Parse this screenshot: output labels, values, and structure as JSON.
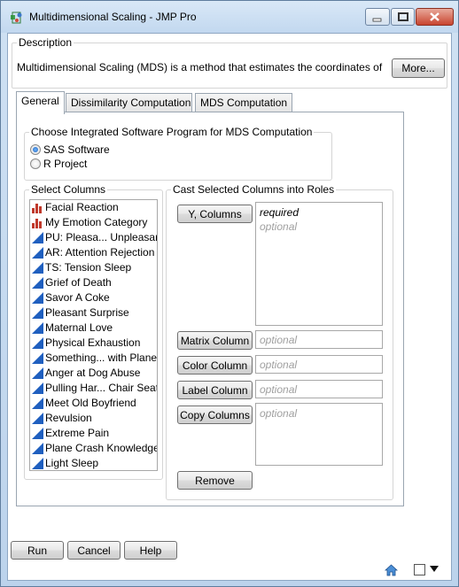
{
  "window": {
    "title": "Multidimensional Scaling - JMP Pro",
    "controls": {
      "minimize": "minimize",
      "maximize": "maximize",
      "close": "close"
    }
  },
  "description": {
    "legend": "Description",
    "text": "Multidimensional Scaling (MDS) is a method that estimates the coordinates of",
    "more_label": "More..."
  },
  "tabs": [
    {
      "label": "General",
      "active": true
    },
    {
      "label": "Dissimilarity Computation",
      "active": false
    },
    {
      "label": "MDS Computation",
      "active": false
    }
  ],
  "software": {
    "legend": "Choose Integrated Software Program for MDS Computation",
    "options": [
      {
        "label": "SAS Software",
        "checked": true
      },
      {
        "label": "R Project",
        "checked": false
      }
    ]
  },
  "select_columns": {
    "legend": "Select Columns",
    "items": [
      {
        "label": "Facial Reaction",
        "icon": "nominal-bar-icon"
      },
      {
        "label": "My Emotion Category",
        "icon": "nominal-bar-icon"
      },
      {
        "label": "PU: Pleasa... Unpleasant",
        "icon": "continuous-triangle-icon"
      },
      {
        "label": "AR: Attention Rejection",
        "icon": "continuous-triangle-icon"
      },
      {
        "label": "TS: Tension Sleep",
        "icon": "continuous-triangle-icon"
      },
      {
        "label": "Grief of Death",
        "icon": "continuous-triangle-icon"
      },
      {
        "label": "Savor A Coke",
        "icon": "continuous-triangle-icon"
      },
      {
        "label": "Pleasant Surprise",
        "icon": "continuous-triangle-icon"
      },
      {
        "label": "Maternal Love",
        "icon": "continuous-triangle-icon"
      },
      {
        "label": "Physical Exhaustion",
        "icon": "continuous-triangle-icon"
      },
      {
        "label": "Something... with Plane",
        "icon": "continuous-triangle-icon"
      },
      {
        "label": "Anger at Dog Abuse",
        "icon": "continuous-triangle-icon"
      },
      {
        "label": "Pulling Har... Chair Seat",
        "icon": "continuous-triangle-icon"
      },
      {
        "label": "Meet Old Boyfriend",
        "icon": "continuous-triangle-icon"
      },
      {
        "label": "Revulsion",
        "icon": "continuous-triangle-icon"
      },
      {
        "label": "Extreme Pain",
        "icon": "continuous-triangle-icon"
      },
      {
        "label": "Plane Crash Knowledge",
        "icon": "continuous-triangle-icon"
      },
      {
        "label": "Light Sleep",
        "icon": "continuous-triangle-icon"
      }
    ]
  },
  "roles": {
    "legend": "Cast Selected Columns into Roles",
    "y_columns": {
      "button": "Y, Columns",
      "required": "required",
      "optional": "optional"
    },
    "matrix": {
      "button": "Matrix Column",
      "placeholder": "optional"
    },
    "color": {
      "button": "Color Column",
      "placeholder": "optional"
    },
    "label": {
      "button": "Label Column",
      "placeholder": "optional"
    },
    "copy": {
      "button": "Copy Columns",
      "placeholder": "optional"
    },
    "remove_label": "Remove"
  },
  "actions": {
    "run": "Run",
    "cancel": "Cancel",
    "help": "Help"
  },
  "status": {
    "home_icon": "home-icon",
    "panel_icon": "panel-toggle-icon",
    "menu_icon": "dropdown-arrow-icon"
  },
  "colors": {
    "nominal": "#c0392b",
    "continuous": "#1f5fbf",
    "title_bg": "#c9dcf1"
  }
}
